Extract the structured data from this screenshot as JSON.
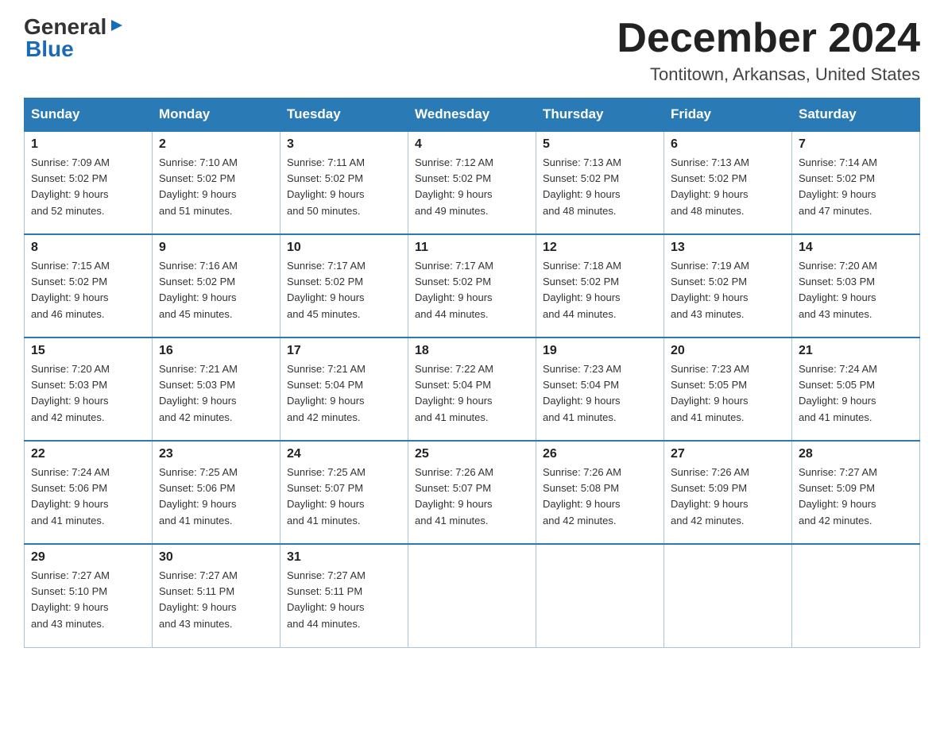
{
  "logo": {
    "part1": "General",
    "arrow": "▶",
    "part2": "Blue"
  },
  "title": {
    "month_year": "December 2024",
    "location": "Tontitown, Arkansas, United States"
  },
  "headers": [
    "Sunday",
    "Monday",
    "Tuesday",
    "Wednesday",
    "Thursday",
    "Friday",
    "Saturday"
  ],
  "weeks": [
    [
      {
        "day": "1",
        "sunrise": "7:09 AM",
        "sunset": "5:02 PM",
        "daylight": "9 hours and 52 minutes."
      },
      {
        "day": "2",
        "sunrise": "7:10 AM",
        "sunset": "5:02 PM",
        "daylight": "9 hours and 51 minutes."
      },
      {
        "day": "3",
        "sunrise": "7:11 AM",
        "sunset": "5:02 PM",
        "daylight": "9 hours and 50 minutes."
      },
      {
        "day": "4",
        "sunrise": "7:12 AM",
        "sunset": "5:02 PM",
        "daylight": "9 hours and 49 minutes."
      },
      {
        "day": "5",
        "sunrise": "7:13 AM",
        "sunset": "5:02 PM",
        "daylight": "9 hours and 48 minutes."
      },
      {
        "day": "6",
        "sunrise": "7:13 AM",
        "sunset": "5:02 PM",
        "daylight": "9 hours and 48 minutes."
      },
      {
        "day": "7",
        "sunrise": "7:14 AM",
        "sunset": "5:02 PM",
        "daylight": "9 hours and 47 minutes."
      }
    ],
    [
      {
        "day": "8",
        "sunrise": "7:15 AM",
        "sunset": "5:02 PM",
        "daylight": "9 hours and 46 minutes."
      },
      {
        "day": "9",
        "sunrise": "7:16 AM",
        "sunset": "5:02 PM",
        "daylight": "9 hours and 45 minutes."
      },
      {
        "day": "10",
        "sunrise": "7:17 AM",
        "sunset": "5:02 PM",
        "daylight": "9 hours and 45 minutes."
      },
      {
        "day": "11",
        "sunrise": "7:17 AM",
        "sunset": "5:02 PM",
        "daylight": "9 hours and 44 minutes."
      },
      {
        "day": "12",
        "sunrise": "7:18 AM",
        "sunset": "5:02 PM",
        "daylight": "9 hours and 44 minutes."
      },
      {
        "day": "13",
        "sunrise": "7:19 AM",
        "sunset": "5:02 PM",
        "daylight": "9 hours and 43 minutes."
      },
      {
        "day": "14",
        "sunrise": "7:20 AM",
        "sunset": "5:03 PM",
        "daylight": "9 hours and 43 minutes."
      }
    ],
    [
      {
        "day": "15",
        "sunrise": "7:20 AM",
        "sunset": "5:03 PM",
        "daylight": "9 hours and 42 minutes."
      },
      {
        "day": "16",
        "sunrise": "7:21 AM",
        "sunset": "5:03 PM",
        "daylight": "9 hours and 42 minutes."
      },
      {
        "day": "17",
        "sunrise": "7:21 AM",
        "sunset": "5:04 PM",
        "daylight": "9 hours and 42 minutes."
      },
      {
        "day": "18",
        "sunrise": "7:22 AM",
        "sunset": "5:04 PM",
        "daylight": "9 hours and 41 minutes."
      },
      {
        "day": "19",
        "sunrise": "7:23 AM",
        "sunset": "5:04 PM",
        "daylight": "9 hours and 41 minutes."
      },
      {
        "day": "20",
        "sunrise": "7:23 AM",
        "sunset": "5:05 PM",
        "daylight": "9 hours and 41 minutes."
      },
      {
        "day": "21",
        "sunrise": "7:24 AM",
        "sunset": "5:05 PM",
        "daylight": "9 hours and 41 minutes."
      }
    ],
    [
      {
        "day": "22",
        "sunrise": "7:24 AM",
        "sunset": "5:06 PM",
        "daylight": "9 hours and 41 minutes."
      },
      {
        "day": "23",
        "sunrise": "7:25 AM",
        "sunset": "5:06 PM",
        "daylight": "9 hours and 41 minutes."
      },
      {
        "day": "24",
        "sunrise": "7:25 AM",
        "sunset": "5:07 PM",
        "daylight": "9 hours and 41 minutes."
      },
      {
        "day": "25",
        "sunrise": "7:26 AM",
        "sunset": "5:07 PM",
        "daylight": "9 hours and 41 minutes."
      },
      {
        "day": "26",
        "sunrise": "7:26 AM",
        "sunset": "5:08 PM",
        "daylight": "9 hours and 42 minutes."
      },
      {
        "day": "27",
        "sunrise": "7:26 AM",
        "sunset": "5:09 PM",
        "daylight": "9 hours and 42 minutes."
      },
      {
        "day": "28",
        "sunrise": "7:27 AM",
        "sunset": "5:09 PM",
        "daylight": "9 hours and 42 minutes."
      }
    ],
    [
      {
        "day": "29",
        "sunrise": "7:27 AM",
        "sunset": "5:10 PM",
        "daylight": "9 hours and 43 minutes."
      },
      {
        "day": "30",
        "sunrise": "7:27 AM",
        "sunset": "5:11 PM",
        "daylight": "9 hours and 43 minutes."
      },
      {
        "day": "31",
        "sunrise": "7:27 AM",
        "sunset": "5:11 PM",
        "daylight": "9 hours and 44 minutes."
      },
      null,
      null,
      null,
      null
    ]
  ],
  "labels": {
    "sunrise": "Sunrise:",
    "sunset": "Sunset:",
    "daylight": "Daylight:"
  }
}
